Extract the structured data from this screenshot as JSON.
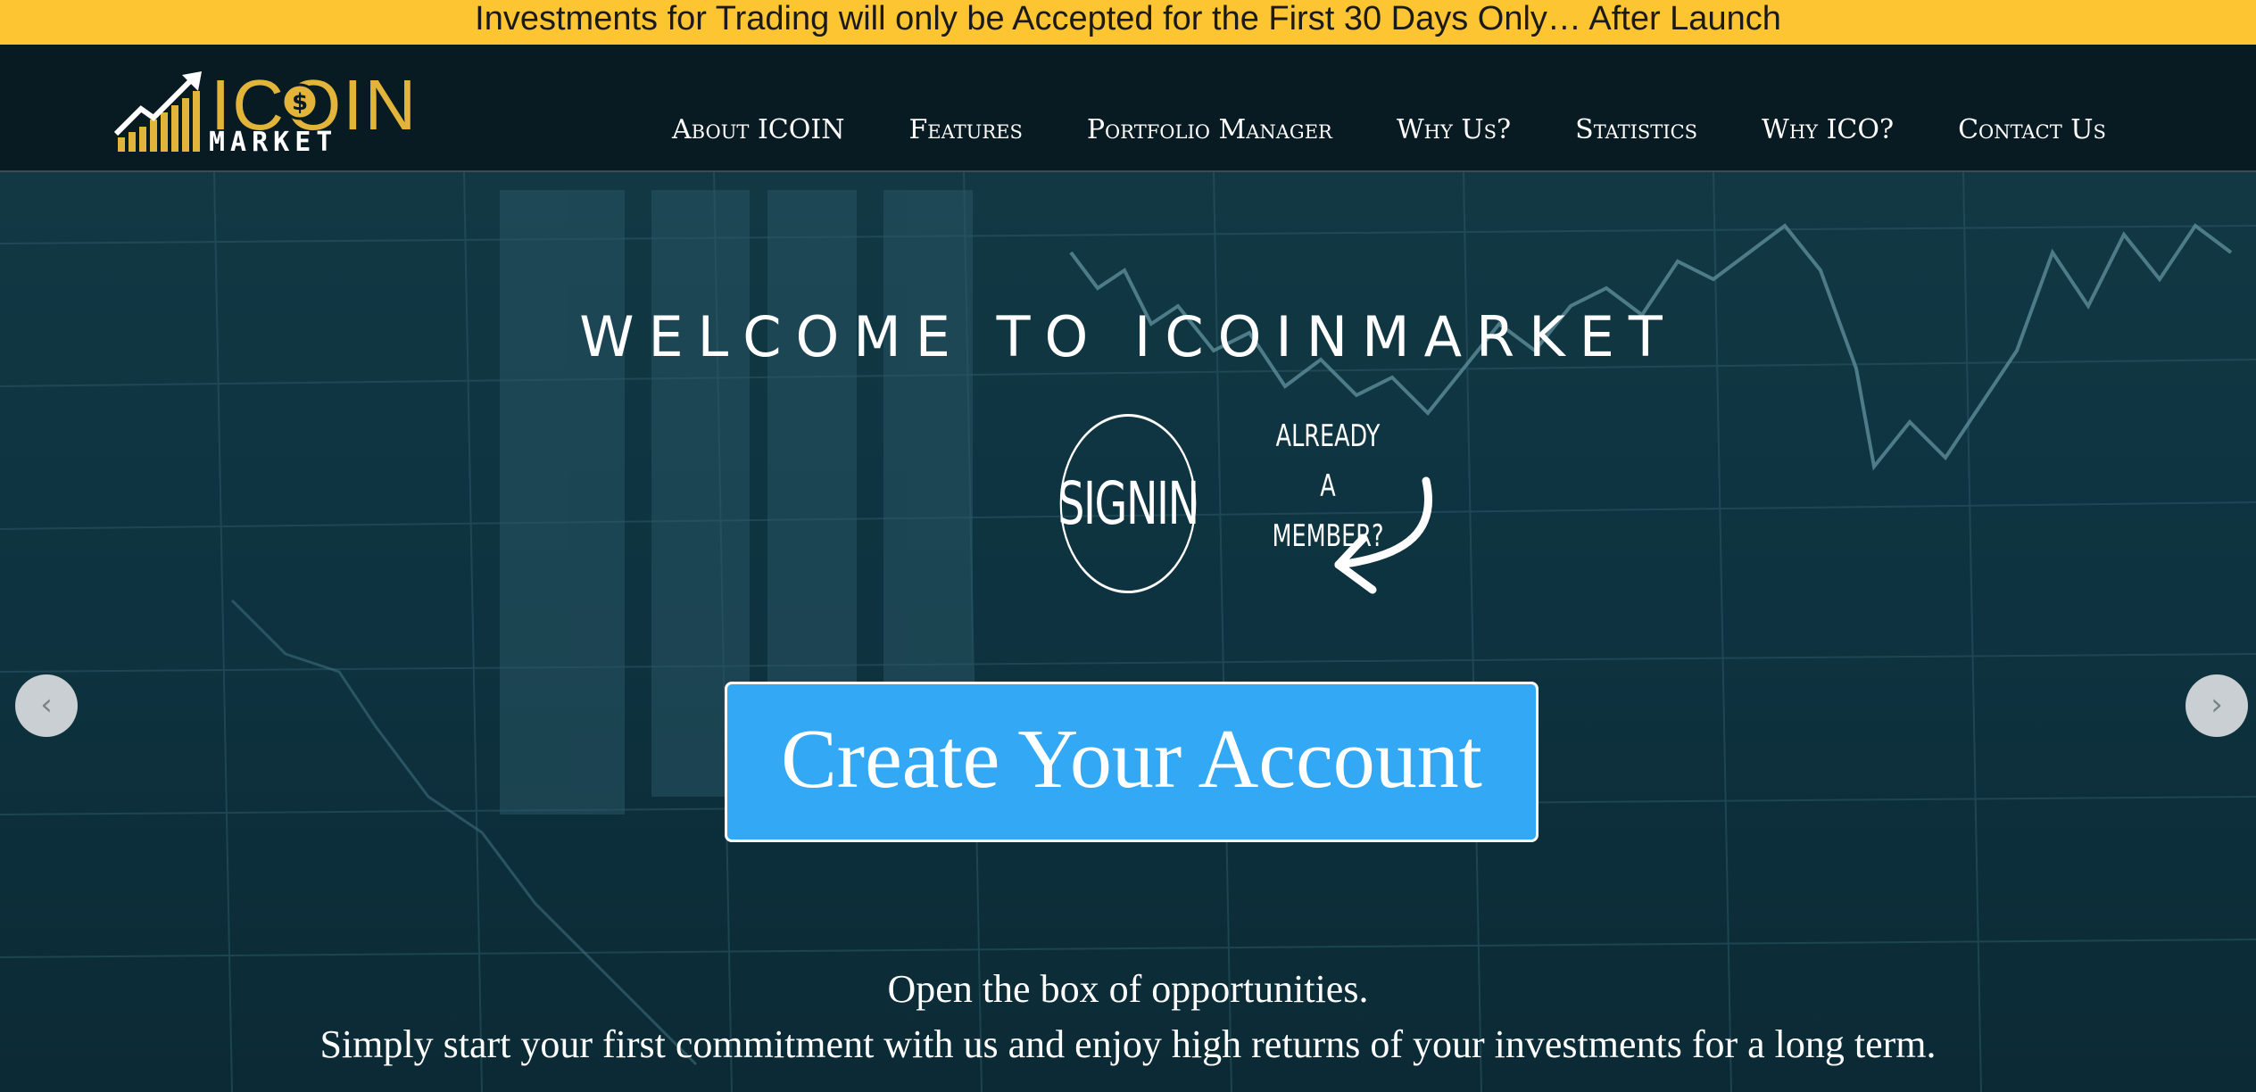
{
  "announcement": {
    "text": "Investments for Trading will only be Accepted for the First 30 Days Only… After Launch"
  },
  "logo": {
    "word": "ICOIN",
    "sub": "MARKET"
  },
  "nav": {
    "items": [
      {
        "label": "About ICOIN"
      },
      {
        "label": "Features"
      },
      {
        "label": "Portfolio Manager"
      },
      {
        "label": "Why Us?"
      },
      {
        "label": "Statistics"
      },
      {
        "label": "Why ICO?"
      },
      {
        "label": "Contact Us"
      }
    ]
  },
  "hero": {
    "title": "WELCOME TO ICOINMARKET",
    "signin_label": "SIGNIN",
    "member_line1": "ALREADY A",
    "member_line2": "MEMBER?",
    "cta_label": "Create Your Account",
    "prev_icon": "chevron-left-icon",
    "next_icon": "chevron-right-icon",
    "prev_glyph": "‹",
    "next_glyph": "›",
    "tagline_line1": "Open the box of opportunities.",
    "tagline_line2": "Simply start your first commitment with us and enjoy high returns of your investments for a long term."
  },
  "colors": {
    "announcement_bg": "#fcc531",
    "nav_bg": "#081a22",
    "logo_gold": "#e2b53a",
    "cta_blue": "#33a8f4",
    "hero_bg": "#0e3340"
  }
}
